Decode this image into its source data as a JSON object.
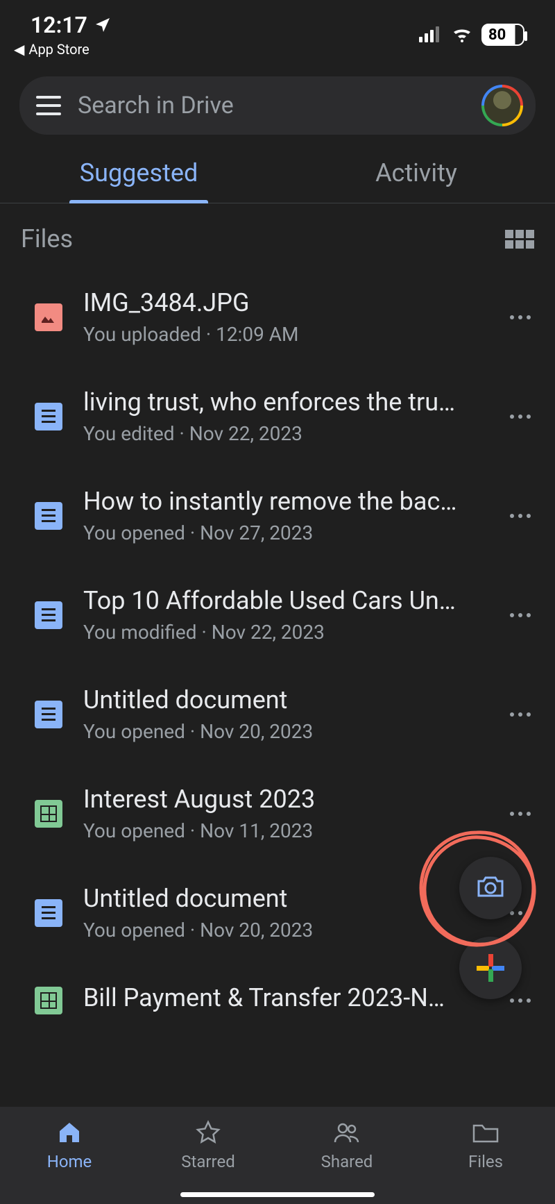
{
  "status": {
    "time": "12:17",
    "back_label": "App Store",
    "battery": "80"
  },
  "search": {
    "placeholder": "Search in Drive"
  },
  "tabs": {
    "suggested": "Suggested",
    "activity": "Activity"
  },
  "section": {
    "title": "Files"
  },
  "files": [
    {
      "name": "IMG_3484.JPG",
      "meta": "You uploaded · 12:09 AM",
      "type": "image"
    },
    {
      "name": "living trust, who enforces the tru…",
      "meta": "You edited · Nov 22, 2023",
      "type": "doc"
    },
    {
      "name": "How to instantly remove the bac…",
      "meta": "You opened · Nov 27, 2023",
      "type": "doc"
    },
    {
      "name": "Top 10 Affordable Used Cars Un…",
      "meta": "You modified · Nov 22, 2023",
      "type": "doc"
    },
    {
      "name": "Untitled document",
      "meta": "You opened · Nov 20, 2023",
      "type": "doc"
    },
    {
      "name": "Interest August 2023",
      "meta": "You opened · Nov 11, 2023",
      "type": "sheet"
    },
    {
      "name": "Untitled document",
      "meta": "You opened · Nov 20, 2023",
      "type": "doc"
    },
    {
      "name": "Bill Payment & Transfer 2023-N…",
      "meta": "",
      "type": "sheet"
    }
  ],
  "nav": {
    "home": "Home",
    "starred": "Starred",
    "shared": "Shared",
    "files": "Files"
  }
}
